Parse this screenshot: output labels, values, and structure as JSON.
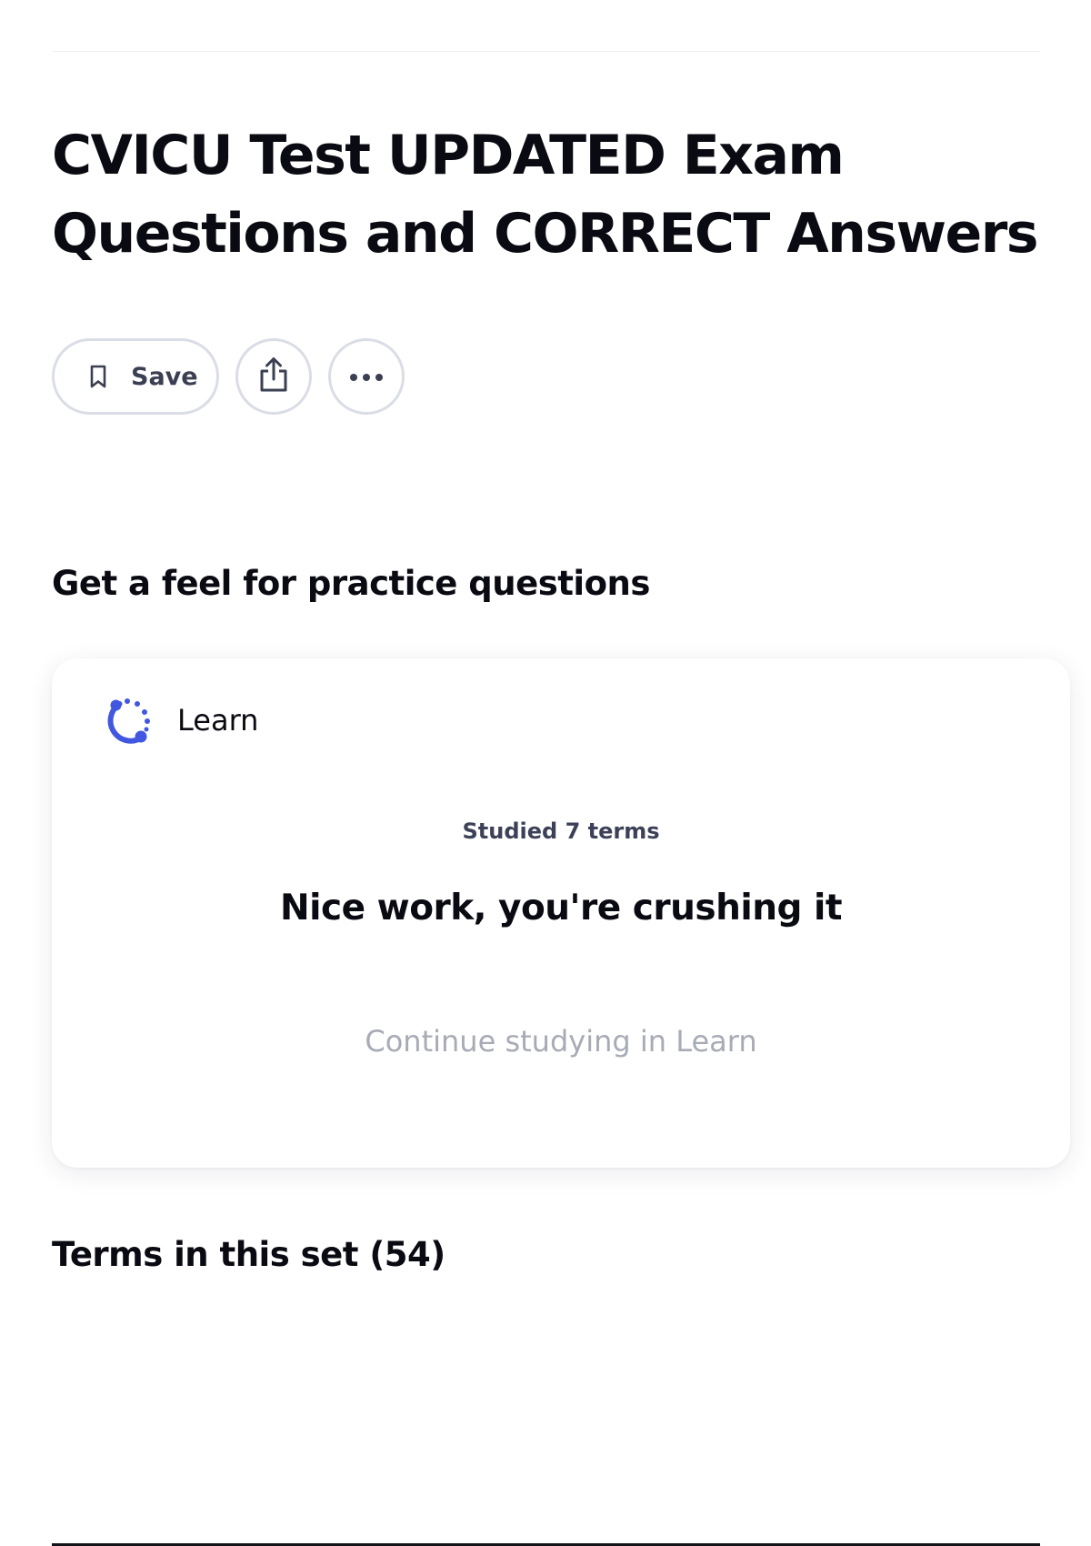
{
  "page": {
    "title": "CVICU Test UPDATED Exam Questions and CORRECT Answers"
  },
  "actions": {
    "save_label": "Save"
  },
  "practice": {
    "heading": "Get a feel for practice questions"
  },
  "learn_card": {
    "mode_label": "Learn",
    "studied_text": "Studied 7 terms",
    "message": "Nice work, you're crushing it",
    "continue_label": "Continue studying in Learn"
  },
  "terms": {
    "heading": "Terms in this set (54)"
  },
  "colors": {
    "accent": "#4257e0",
    "button_border": "#dadde5",
    "muted_text": "#a8abb6"
  },
  "icons": [
    "bookmark-icon",
    "share-icon",
    "more-options-icon",
    "learn-progress-icon"
  ]
}
